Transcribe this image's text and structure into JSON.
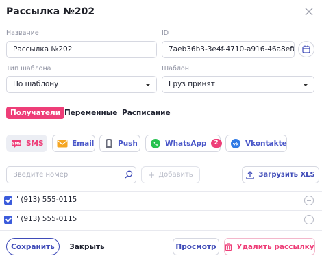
{
  "dialog": {
    "title": "Рассылка №202"
  },
  "form": {
    "name_label": "Название",
    "name_value": "Рассылка №202",
    "id_label": "ID",
    "id_value": "7aeb36b3-3e4f-4710-a916-46a8ef0",
    "template_type_label": "Тип шаблона",
    "template_type_value": "По шаблону",
    "template_label": "Шаблон",
    "template_value": "Груз принят"
  },
  "tabs": [
    {
      "label": "Получатели",
      "active": true
    },
    {
      "label": "Переменные",
      "active": false
    },
    {
      "label": "Расписание",
      "active": false
    }
  ],
  "channels": [
    {
      "label": "SMS",
      "icon": "sms-icon",
      "active": true
    },
    {
      "label": "Email",
      "icon": "email-icon",
      "active": false
    },
    {
      "label": "Push",
      "icon": "push-icon",
      "active": false
    },
    {
      "label": "WhatsApp",
      "icon": "whatsapp-icon",
      "active": false,
      "badge": "2"
    },
    {
      "label": "Vkontakte",
      "icon": "vk-icon",
      "active": false
    }
  ],
  "recipients_toolbar": {
    "search_placeholder": "Введите номер",
    "add_label": "Добавить",
    "upload_label": "Загрузить XLS"
  },
  "recipients": [
    {
      "phone": "' (913) 555-0115",
      "checked": true
    },
    {
      "phone": "' (913) 555-0115",
      "checked": true
    }
  ],
  "footer": {
    "save_label": "Сохранить",
    "close_label": "Закрыть",
    "preview_label": "Просмотр",
    "delete_label": "Удалить рассылку"
  },
  "colors": {
    "accent_pink": "#ee3e78",
    "accent_blue": "#3f4bb8",
    "checkbox_blue": "#3b5bdb",
    "whatsapp_green": "#25c24f",
    "email_orange": "#f5a623",
    "vk_blue": "#2f7ae5"
  }
}
